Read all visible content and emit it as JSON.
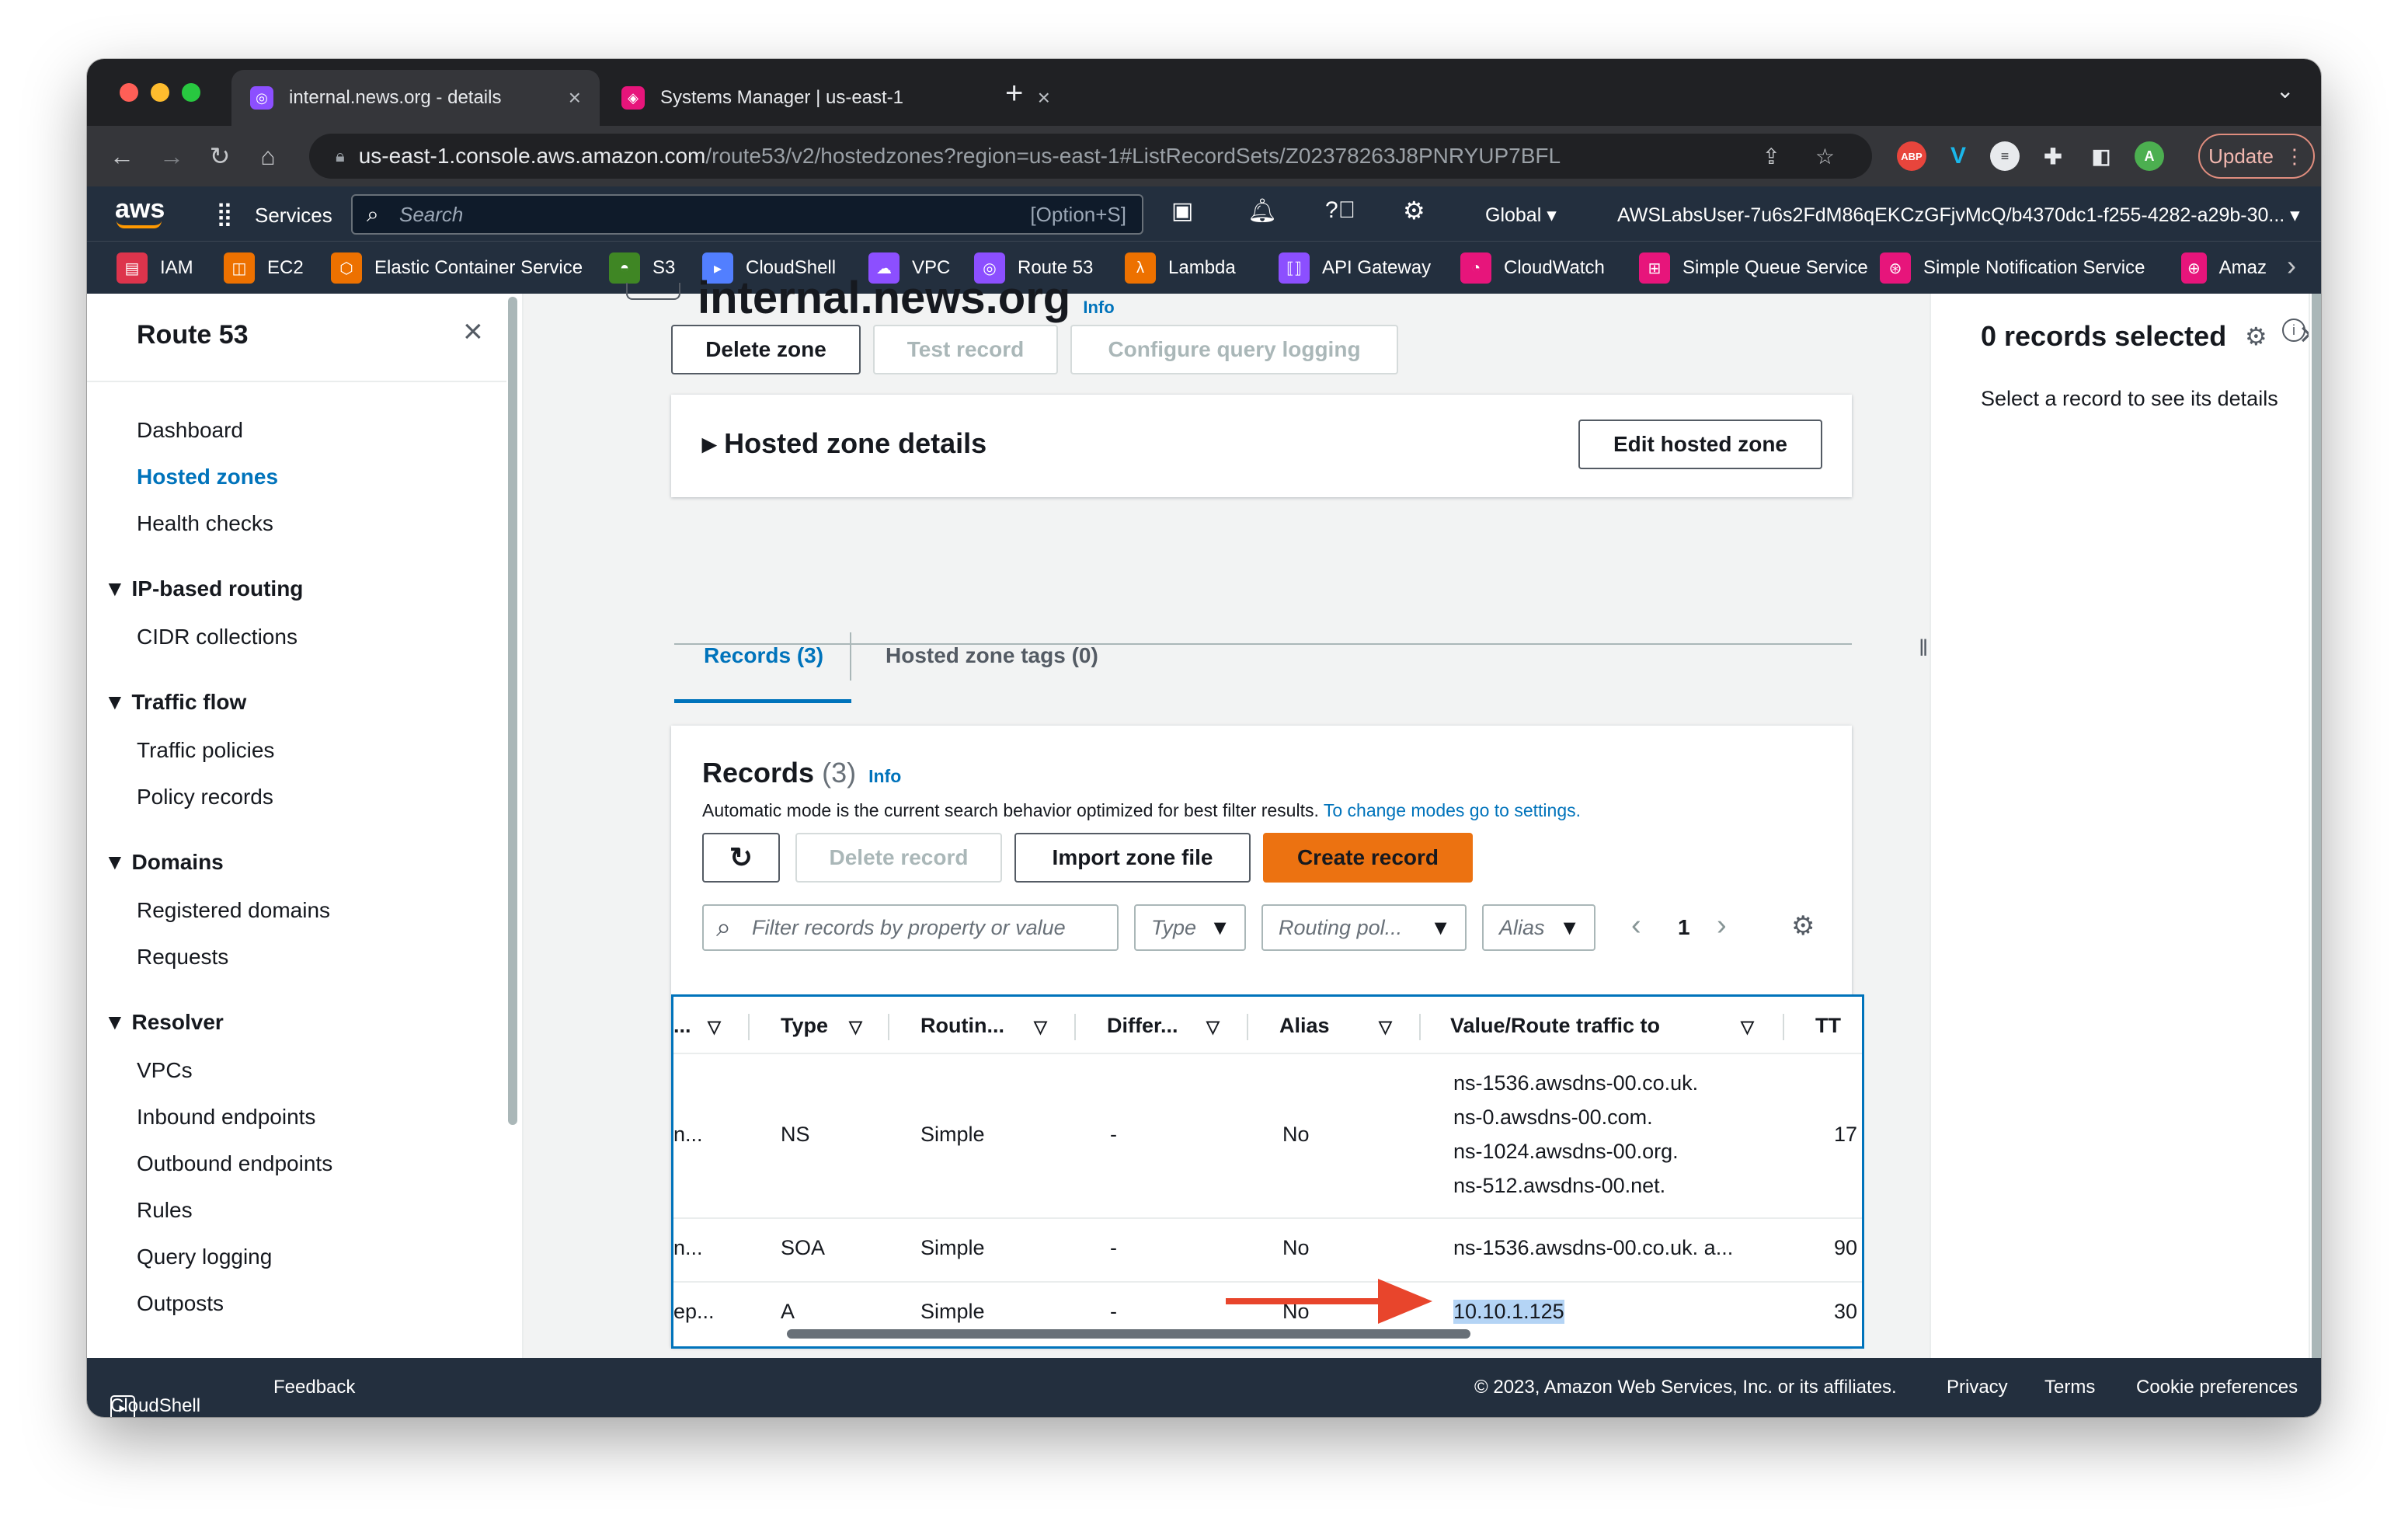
{
  "browser": {
    "tabs": [
      {
        "title": "internal.news.org - details",
        "active": true
      },
      {
        "title": "Systems Manager | us-east-1",
        "active": false
      }
    ],
    "url_host": "us-east-1.console.aws.amazon.com",
    "url_path": "/route53/v2/hostedzones?region=us-east-1#ListRecordSets/Z02378263J8PNRYUP7BFL",
    "update_label": "Update",
    "ext_abp": "ABP",
    "avatar_letter": "A"
  },
  "awsnav": {
    "logo": "aws",
    "services_label": "Services",
    "search_placeholder": "Search",
    "search_shortcut": "[Option+S]",
    "region": "Global",
    "account": "AWSLabsUser-7u6s2FdM86qEKCzGFjvMcQ/b4370dc1-f255-4282-a29b-30...",
    "favorites": [
      "IAM",
      "EC2",
      "Elastic Container Service",
      "S3",
      "CloudShell",
      "VPC",
      "Route 53",
      "Lambda",
      "API Gateway",
      "CloudWatch",
      "Simple Queue Service",
      "Simple Notification Service",
      "Amaz"
    ]
  },
  "sidebar": {
    "title": "Route 53",
    "items": [
      "Dashboard",
      "Hosted zones",
      "Health checks"
    ],
    "sections": [
      {
        "title": "IP-based routing",
        "items": [
          "CIDR collections"
        ]
      },
      {
        "title": "Traffic flow",
        "items": [
          "Traffic policies",
          "Policy records"
        ]
      },
      {
        "title": "Domains",
        "items": [
          "Registered domains",
          "Requests"
        ]
      },
      {
        "title": "Resolver",
        "items": [
          "VPCs",
          "Inbound endpoints",
          "Outbound endpoints",
          "Rules",
          "Query logging",
          "Outposts"
        ]
      }
    ]
  },
  "zone": {
    "partial_title": "internal.news.org",
    "info": "Info",
    "buttons": {
      "delete_zone": "Delete zone",
      "test_record": "Test record",
      "configure_logging": "Configure query logging"
    },
    "details_title": "Hosted zone details",
    "edit_label": "Edit hosted zone",
    "tabs": [
      "Records (3)",
      "Hosted zone tags (0)"
    ]
  },
  "records": {
    "title": "Records",
    "count": "(3)",
    "info": "Info",
    "description": "Automatic mode is the current search behavior optimized for best filter results.",
    "settings_link": "To change modes go to settings.",
    "delete_label": "Delete record",
    "import_label": "Import zone file",
    "create_label": "Create record",
    "filter_placeholder": "Filter records by property or value",
    "dropdowns": [
      "Type",
      "Routing pol...",
      "Alias"
    ],
    "page": "1",
    "columns": [
      "...",
      "Type",
      "Routin...",
      "Differ...",
      "Alias",
      "Value/Route traffic to",
      "TT"
    ],
    "rows": [
      {
        "name": "n...",
        "type": "NS",
        "routing": "Simple",
        "diff": "-",
        "alias": "No",
        "values": [
          "ns-1536.awsdns-00.co.uk.",
          "ns-0.awsdns-00.com.",
          "ns-1024.awsdns-00.org.",
          "ns-512.awsdns-00.net."
        ],
        "ttl": "17"
      },
      {
        "name": "n...",
        "type": "SOA",
        "routing": "Simple",
        "diff": "-",
        "alias": "No",
        "values": [
          "ns-1536.awsdns-00.co.uk. a..."
        ],
        "ttl": "90"
      },
      {
        "name": "ep...",
        "type": "A",
        "routing": "Simple",
        "diff": "-",
        "alias": "No",
        "values": [
          "10.10.1.125"
        ],
        "ttl": "30"
      }
    ]
  },
  "detail_panel": {
    "title": "0 records selected",
    "message": "Select a record to see its details"
  },
  "footer": {
    "cloudshell": "CloudShell",
    "feedback": "Feedback",
    "copyright": "© 2023, Amazon Web Services, Inc. or its affiliates.",
    "links": [
      "Privacy",
      "Terms",
      "Cookie preferences"
    ]
  },
  "colors": {
    "accent_link": "#0073bb",
    "primary_button": "#ec7211",
    "aws_nav": "#232f3e",
    "annotation_arrow": "#e8452c"
  }
}
